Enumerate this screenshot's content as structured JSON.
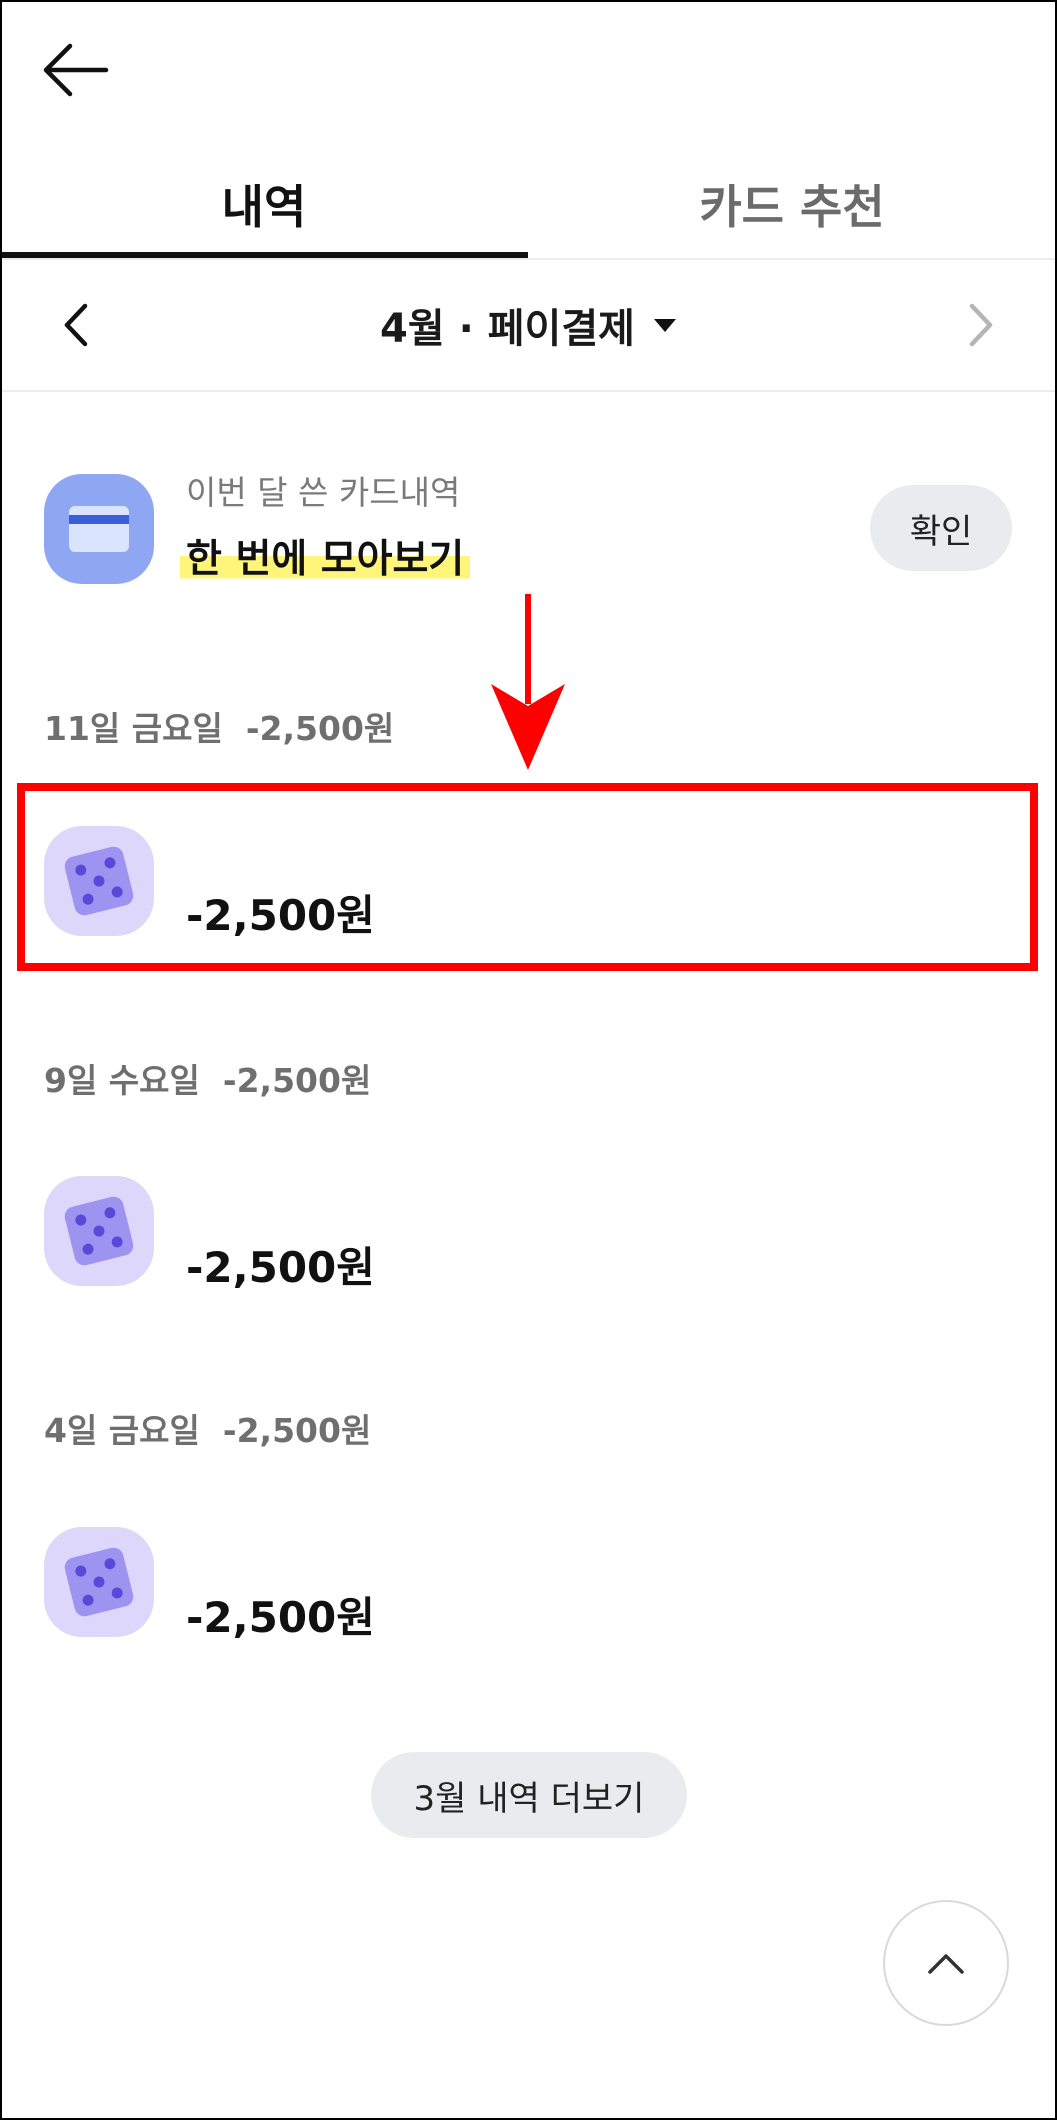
{
  "header": {
    "back_icon": "arrow-left-icon"
  },
  "tabs": [
    {
      "label": "내역",
      "active": true
    },
    {
      "label": "카드 추천",
      "active": false
    }
  ],
  "month_bar": {
    "title": "4월 · 페이결제",
    "prev_icon": "chevron-left-icon",
    "next_icon": "chevron-right-icon",
    "dropdown_icon": "caret-down-icon"
  },
  "banner": {
    "subtitle": "이번 달 쓴 카드내역",
    "title": "한 번에 모아보기",
    "confirm_label": "확인",
    "icon": "credit-card-icon",
    "highlight_color": "#fff57a"
  },
  "transactions": [
    {
      "date": "11일 금요일",
      "total": "-2,500원",
      "amount": "-2,500원",
      "icon": "dice-icon"
    },
    {
      "date": "9일 수요일",
      "total": "-2,500원",
      "amount": "-2,500원",
      "icon": "dice-icon"
    },
    {
      "date": "4일 금요일",
      "total": "-2,500원",
      "amount": "-2,500원",
      "icon": "dice-icon"
    }
  ],
  "more_label": "3월 내역 더보기",
  "scroll_top_icon": "chevron-up-icon",
  "colors": {
    "annotation": "#ff0000",
    "dice_bg": "#dcd7fb",
    "dice_face": "#9d93f0",
    "dice_dot": "#5b48d9",
    "card_bg": "#8fa7f2"
  }
}
